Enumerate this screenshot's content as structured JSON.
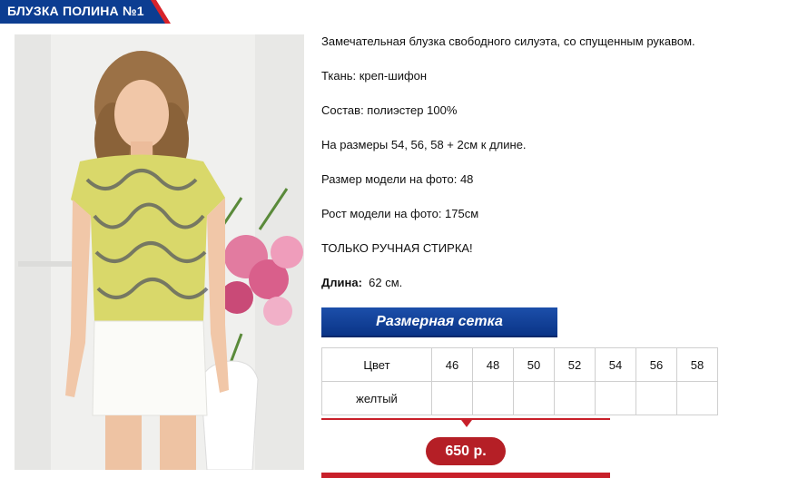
{
  "product": {
    "title": "БЛУЗКА ПОЛИНА №1",
    "photo_alt": "",
    "description": {
      "intro": "Замечательная блузка свободного силуэта, со спущенным рукавом.",
      "fabric": "Ткань: креп-шифон",
      "composition": "Состав: полиэстер 100%",
      "sizes_note": "На размеры 54, 56, 58 + 2см к длине.",
      "model_size": "Размер модели на фото: 48",
      "model_height": "Рост модели на фото: 175см",
      "care": "ТОЛЬКО РУЧНАЯ СТИРКА!",
      "length_label": "Длина:",
      "length_value": "62 см."
    }
  },
  "size_chart": {
    "button_label": "Размерная сетка",
    "header": [
      "Цвет",
      "46",
      "48",
      "50",
      "52",
      "54",
      "56",
      "58"
    ],
    "rows": [
      {
        "color": "желтый",
        "values": [
          "",
          "",
          "",
          "",
          "",
          "",
          ""
        ]
      }
    ]
  },
  "price": {
    "label": "650 р."
  },
  "colors": {
    "brand_blue": "#0c3d91",
    "accent_red": "#d8232a",
    "price_red": "#b51f26"
  }
}
